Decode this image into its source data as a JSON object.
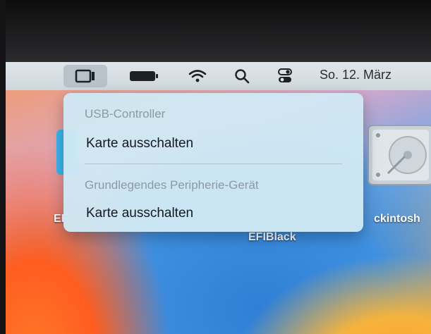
{
  "menubar": {
    "icons": [
      "screen-icon",
      "battery-icon",
      "wifi-icon",
      "search-icon",
      "control-center-icon"
    ],
    "clock": "So. 12. März"
  },
  "desktop": {
    "items": [
      {
        "label": "EF",
        "icon": "folder-icon"
      },
      {
        "label": "EFIBlack",
        "icon": "disk-icon"
      },
      {
        "label": "ckintosh",
        "icon": "hard-drive-icon"
      }
    ]
  },
  "dropdown": {
    "sections": [
      {
        "header": "USB-Controller",
        "action": "Karte ausschalten"
      },
      {
        "header": "Grundlegendes Peripherie-Gerät",
        "action": "Karte ausschalten"
      }
    ]
  },
  "colors": {
    "menubar": "#d6dfe4",
    "menu_background": "#cfe8f4",
    "menu_header": "#8c9aa3",
    "wallpaper_orange": "#ff5d1f",
    "wallpaper_blue": "#3e8fe0"
  }
}
